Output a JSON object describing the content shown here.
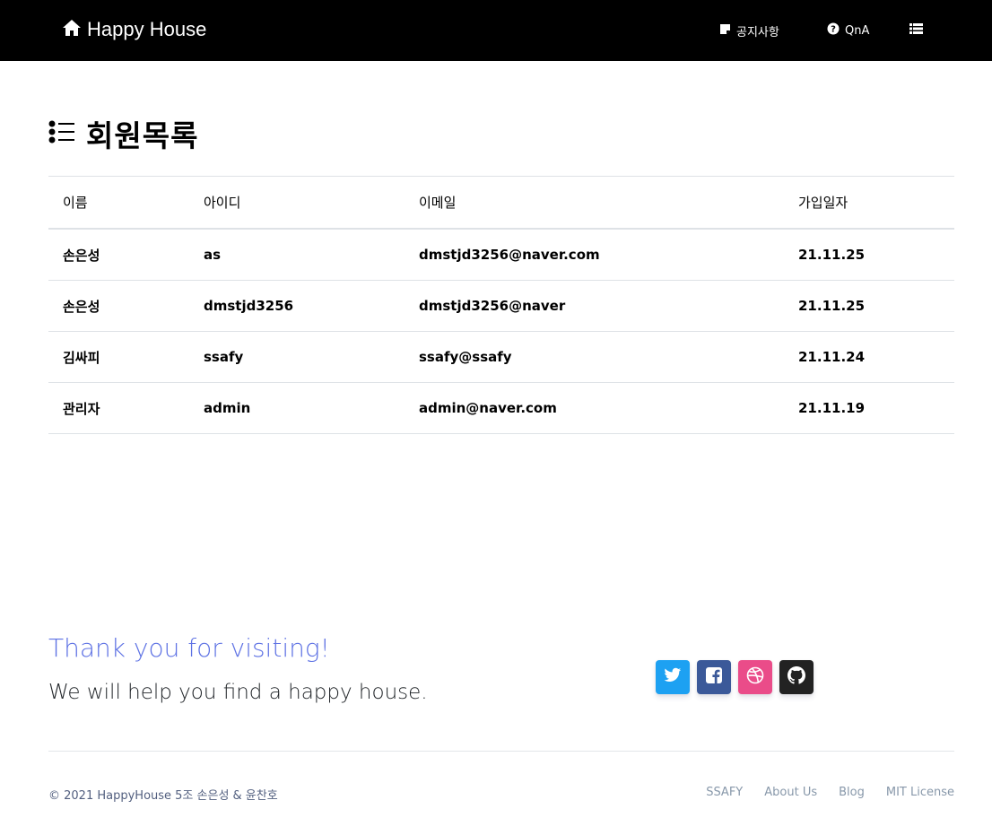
{
  "navbar": {
    "brand": "Happy House",
    "brand_icon": "home-icon",
    "links": [
      {
        "label": "공지사항",
        "icon": "sticky-note-icon"
      },
      {
        "label": "QnA",
        "icon": "question-circle-icon"
      },
      {
        "label": "",
        "icon": "list-icon"
      }
    ]
  },
  "page": {
    "title": "회원목록",
    "title_icon": "list-ul-icon"
  },
  "table": {
    "columns": [
      "이름",
      "아이디",
      "이메일",
      "가입일자"
    ],
    "rows": [
      [
        "손은성",
        "as",
        "dmstjd3256@naver.com",
        "21.11.25"
      ],
      [
        "손은성",
        "dmstjd3256",
        "dmstjd3256@naver",
        "21.11.25"
      ],
      [
        "김싸피",
        "ssafy",
        "ssafy@ssafy",
        "21.11.24"
      ],
      [
        "관리자",
        "admin",
        "admin@naver.com",
        "21.11.19"
      ]
    ]
  },
  "footer": {
    "thanks": "Thank you for visiting!",
    "help": "We will help you find a happy house.",
    "social": [
      {
        "icon": "twitter-icon",
        "color": "#1da1f2"
      },
      {
        "icon": "facebook-icon",
        "color": "#3b5999"
      },
      {
        "icon": "dribbble-icon",
        "color": "#ea4c89"
      },
      {
        "icon": "github-icon",
        "color": "#222222"
      }
    ],
    "copyright": "© 2021 HappyHouse 5조 손은성 & 윤찬호",
    "links": [
      "SSAFY",
      "About Us",
      "Blog",
      "MIT License"
    ]
  },
  "colors": {
    "navbar_bg": "#000000",
    "accent": "#5e72e4"
  }
}
